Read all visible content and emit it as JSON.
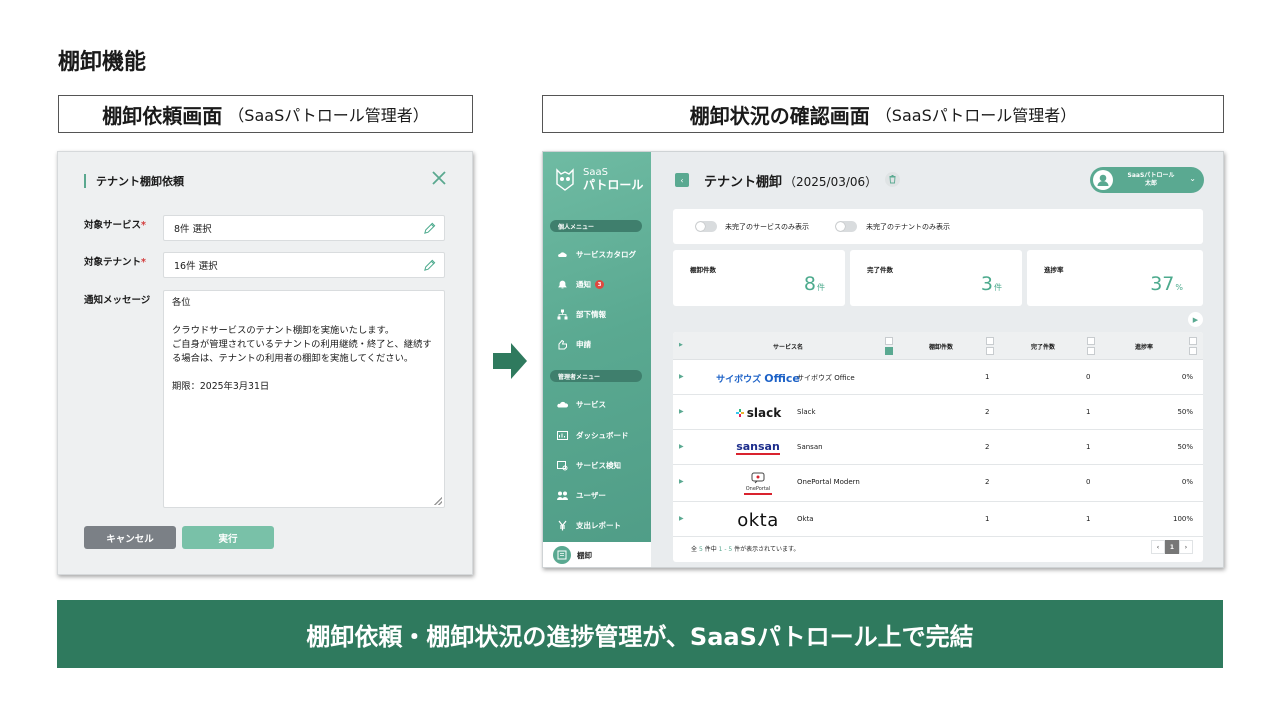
{
  "slide": {
    "title": "棚卸機能",
    "left_heading": "棚卸依頼画面",
    "left_heading_sub": "（SaaSパトロール管理者）",
    "right_heading": "棚卸状況の確認画面",
    "right_heading_sub": "（SaaSパトロール管理者）",
    "banner": "棚卸依頼・棚卸状況の進捗管理が、SaaSパトロール上で完結"
  },
  "dialog": {
    "title": "テナント棚卸依頼",
    "service_label": "対象サービス",
    "service_value": "8件 選択",
    "tenant_label": "対象テナント",
    "tenant_value": "16件 選択",
    "message_label": "通知メッセージ",
    "message_greeting": "各位",
    "message_body": "クラウドサービスのテナント棚卸を実施いたします。\nご自身が管理されているテナントの利用継続・終了と、継続する場合は、テナントの利用者の棚卸を実施してください。",
    "message_deadline": "期限：2025年3月31日",
    "cancel_label": "キャンセル",
    "run_label": "実行",
    "required_mark": "*"
  },
  "app": {
    "logo_line1": "SaaS",
    "logo_line2": "パトロール",
    "personal_menu": "個人メニュー",
    "admin_menu": "管理者メニュー",
    "menu_personal": [
      "サービスカタログ",
      "通知",
      "部下情報",
      "申請"
    ],
    "notification_count": "3",
    "menu_admin": [
      "サービス",
      "ダッシュボード",
      "サービス検知",
      "ユーザー",
      "支出レポート"
    ],
    "active_menu": "棚卸",
    "page_title": "テナント棚卸",
    "page_date": "（2025/03/06）",
    "user_line1": "SaaSパトロール",
    "user_line2": "太郎",
    "filter1": "未完了のサービスのみ表示",
    "filter2": "未完了のテナントのみ表示",
    "stats": [
      {
        "label": "棚卸件数",
        "value": "8",
        "unit": "件"
      },
      {
        "label": "完了件数",
        "value": "3",
        "unit": "件"
      },
      {
        "label": "進捗率",
        "value": "37",
        "unit": "%"
      }
    ],
    "table_headers": [
      "サービス名",
      "棚卸件数",
      "完了件数",
      "進捗率"
    ],
    "rows": [
      {
        "logo": "サイボウズ",
        "logo_strong": "Office",
        "name": "サイボウズ Office",
        "count": "1",
        "done": "0",
        "rate": "0%"
      },
      {
        "logo": "slack",
        "name": "Slack",
        "count": "2",
        "done": "1",
        "rate": "50%"
      },
      {
        "logo": "sansan",
        "name": "Sansan",
        "count": "2",
        "done": "1",
        "rate": "50%"
      },
      {
        "logo": "OnePortal",
        "name": "OnePortal Modern",
        "count": "2",
        "done": "0",
        "rate": "0%"
      },
      {
        "logo": "okta",
        "name": "Okta",
        "count": "1",
        "done": "1",
        "rate": "100%"
      }
    ],
    "footer_prefix": "全",
    "footer_total": "5",
    "footer_mid": "件中",
    "footer_range": "1 - 5",
    "footer_suffix": "件が表示されています。",
    "page_prev": "‹",
    "page_current": "1",
    "page_next": "›"
  },
  "colors": {
    "accent": "#5aa991",
    "banner": "#2f7a5e",
    "cancel": "#7b8086",
    "run": "#79c1a8"
  }
}
